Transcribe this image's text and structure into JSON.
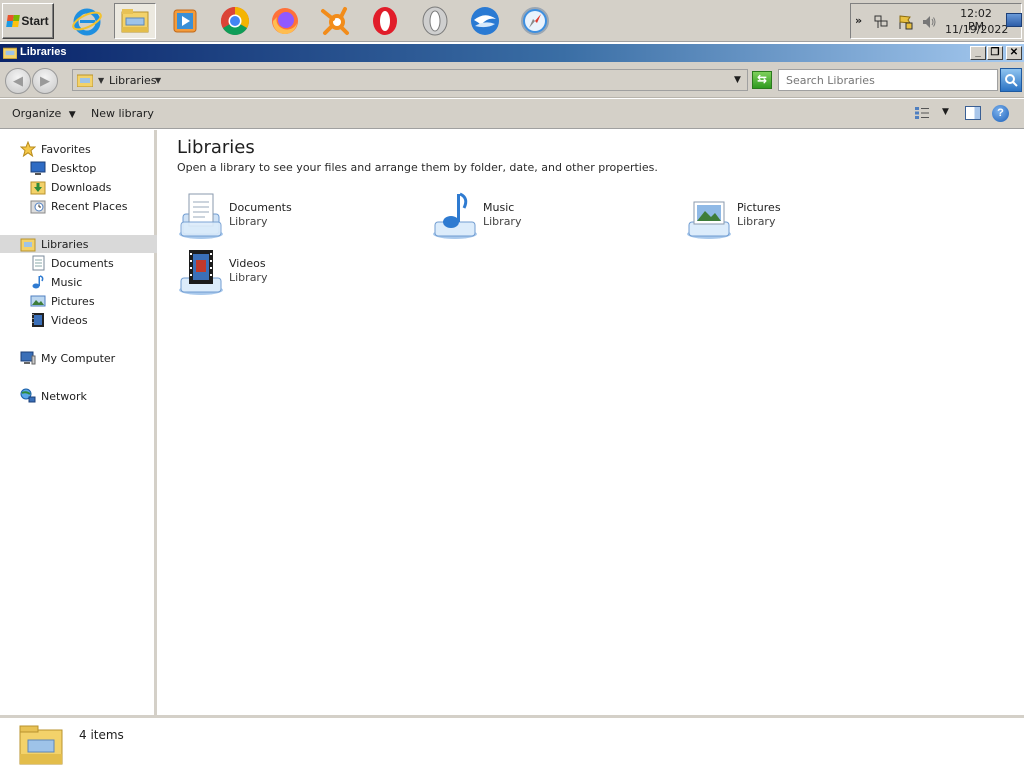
{
  "taskbar": {
    "start_label": "Start",
    "apps": [
      {
        "name": "Internet Explorer",
        "icon": "internet-explorer-icon"
      },
      {
        "name": "Windows Explorer",
        "icon": "file-explorer-icon",
        "active": true
      },
      {
        "name": "Windows Media Player",
        "icon": "media-player-icon"
      },
      {
        "name": "Google Chrome",
        "icon": "chrome-icon"
      },
      {
        "name": "Mozilla Firefox",
        "icon": "firefox-icon"
      },
      {
        "name": "Avast",
        "icon": "avast-icon"
      },
      {
        "name": "Opera",
        "icon": "opera-icon"
      },
      {
        "name": "Opera Neon",
        "icon": "opera-neon-icon"
      },
      {
        "name": "Thunderbird",
        "icon": "thunderbird-icon"
      },
      {
        "name": "Safari",
        "icon": "safari-icon"
      }
    ],
    "clock_time": "12:02 PM",
    "clock_date": "11/19/2022"
  },
  "window": {
    "title": "Libraries",
    "minimize": "_",
    "restore": "❐",
    "close": "✕"
  },
  "address": {
    "path": "Libraries",
    "search_placeholder": "Search Libraries"
  },
  "commands": {
    "organize": "Organize",
    "new_library": "New library"
  },
  "nav": {
    "favorites": "Favorites",
    "desktop": "Desktop",
    "downloads": "Downloads",
    "recent_places": "Recent Places",
    "libraries": "Libraries",
    "documents": "Documents",
    "music": "Music",
    "pictures": "Pictures",
    "videos": "Videos",
    "my_computer": "My Computer",
    "network": "Network"
  },
  "content": {
    "title": "Libraries",
    "subtitle": "Open a library to see your files and arrange them by folder, date, and other properties.",
    "libraries": [
      {
        "name": "Documents",
        "type": "Library"
      },
      {
        "name": "Music",
        "type": "Library"
      },
      {
        "name": "Pictures",
        "type": "Library"
      },
      {
        "name": "Videos",
        "type": "Library"
      }
    ]
  },
  "details": {
    "count": "4 items"
  },
  "colors": {
    "titlebar_start": "#0a246a",
    "titlebar_end": "#a6caf0",
    "chrome_face": "#d4d0c8",
    "selection": "#d9d9d9"
  }
}
